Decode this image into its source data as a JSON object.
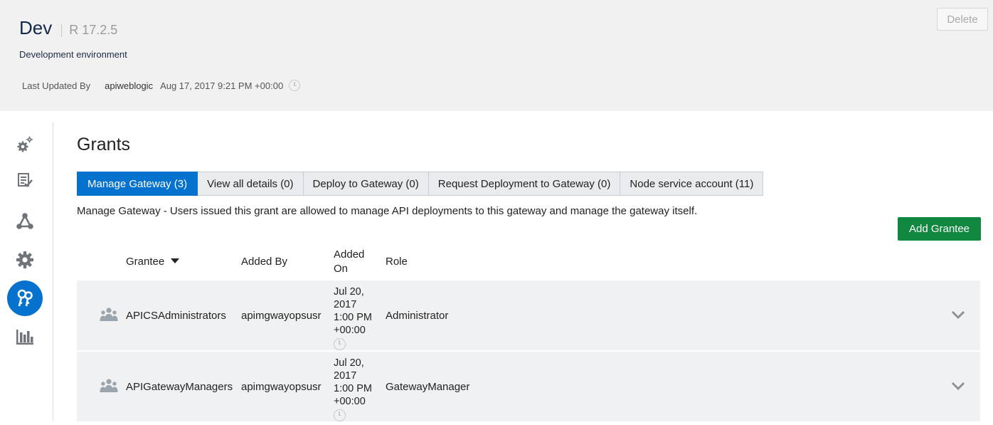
{
  "header": {
    "env_name": "Dev",
    "version": "R 17.2.5",
    "description": "Development environment",
    "last_updated_label": "Last Updated By",
    "last_updated_user": "apiweblogic",
    "last_updated_date": "Aug 17, 2017 9:21 PM +00:00",
    "delete_label": "Delete"
  },
  "sidebar": {
    "items": [
      {
        "icon": "settings-cogs-icon",
        "active": false
      },
      {
        "icon": "checklist-icon",
        "active": false
      },
      {
        "icon": "network-nodes-icon",
        "active": false
      },
      {
        "icon": "gear-icon",
        "active": false
      },
      {
        "icon": "keys-icon",
        "active": true
      },
      {
        "icon": "bar-chart-icon",
        "active": false
      }
    ]
  },
  "main": {
    "title": "Grants",
    "tabs": [
      {
        "label": "Manage Gateway (3)",
        "active": true
      },
      {
        "label": "View all details (0)",
        "active": false
      },
      {
        "label": "Deploy to Gateway (0)",
        "active": false
      },
      {
        "label": "Request Deployment to Gateway (0)",
        "active": false
      },
      {
        "label": "Node service account (11)",
        "active": false
      }
    ],
    "tab_description": "Manage Gateway - Users issued this grant are allowed to manage API deployments to this gateway and manage the gateway itself.",
    "add_button": "Add Grantee",
    "table": {
      "headers": {
        "grantee": "Grantee",
        "added_by": "Added By",
        "added_on_1": "Added",
        "added_on_2": "On",
        "role": "Role"
      },
      "rows": [
        {
          "grantee": "APICSAdministrators",
          "added_by": "apimgwayopsusr",
          "date_1": "Jul 20,",
          "date_2": "2017",
          "date_3": "1:00 PM",
          "date_4": "+00:00",
          "role": "Administrator"
        },
        {
          "grantee": "APIGatewayManagers",
          "added_by": "apimgwayopsusr",
          "date_1": "Jul 20,",
          "date_2": "2017",
          "date_3": "1:00 PM",
          "date_4": "+00:00",
          "role": "GatewayManager"
        }
      ]
    }
  },
  "colors": {
    "accent": "#0572ce",
    "add_button": "#12873f",
    "header_bg": "#f1f1f1",
    "row_bg": "#f0f1f2"
  }
}
